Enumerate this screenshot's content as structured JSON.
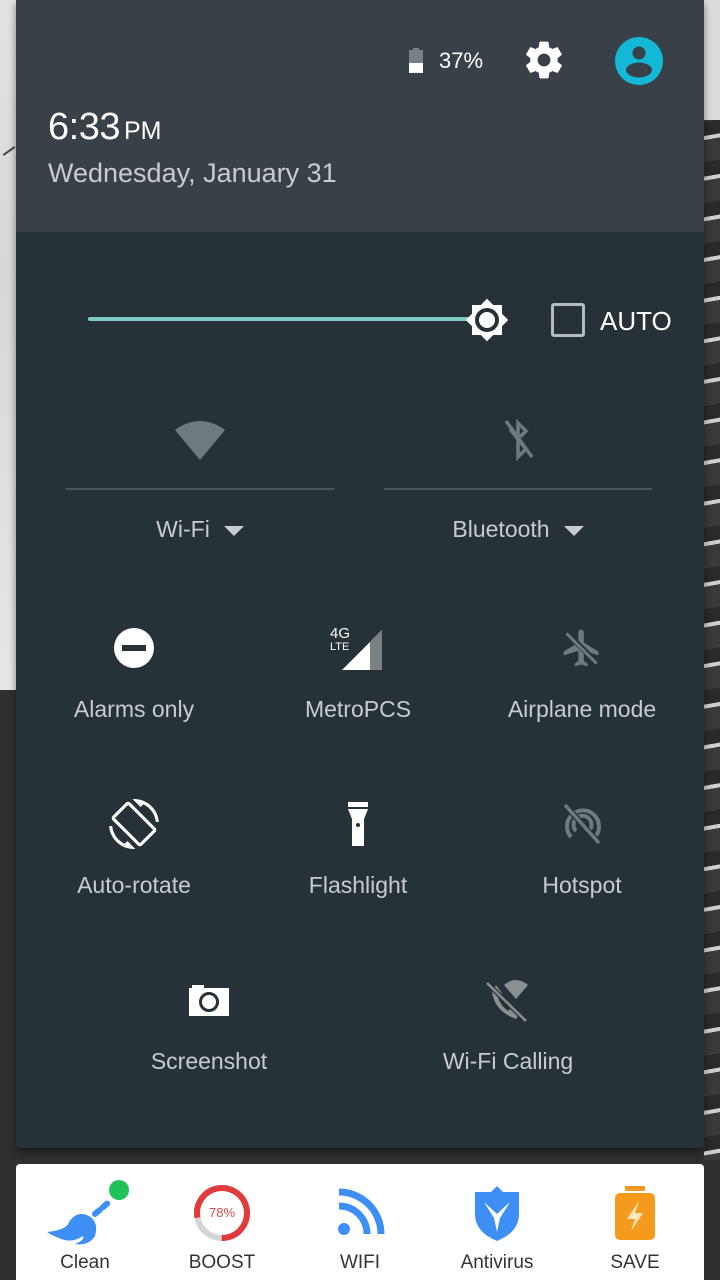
{
  "status": {
    "battery_percent": "37%",
    "battery_level": 0.37,
    "settings_icon": "gear-icon",
    "user_icon": "account-circle-icon"
  },
  "header": {
    "time": "6:33",
    "ampm": "PM",
    "date": "Wednesday, January 31"
  },
  "brightness": {
    "level": 0.95,
    "auto_label": "AUTO",
    "auto_checked": false
  },
  "big_tiles": [
    {
      "label": "Wi-Fi",
      "icon": "wifi-icon",
      "state": "off"
    },
    {
      "label": "Bluetooth",
      "icon": "bluetooth-disabled-icon",
      "state": "off"
    }
  ],
  "tiles": [
    {
      "label": "Alarms only",
      "icon": "do-not-disturb-icon",
      "state": "on"
    },
    {
      "label": "MetroPCS",
      "icon": "cellular-4g-lte-icon",
      "state": "on",
      "network": "4G",
      "network_sub": "LTE"
    },
    {
      "label": "Airplane mode",
      "icon": "airplane-off-icon",
      "state": "off"
    },
    {
      "label": "Auto-rotate",
      "icon": "screen-rotation-icon",
      "state": "on"
    },
    {
      "label": "Flashlight",
      "icon": "flashlight-icon",
      "state": "on"
    },
    {
      "label": "Hotspot",
      "icon": "hotspot-off-icon",
      "state": "off"
    },
    {
      "label": "Screenshot",
      "icon": "camera-icon",
      "state": "on"
    },
    {
      "label": "Wi-Fi Calling",
      "icon": "wifi-calling-off-icon",
      "state": "off"
    }
  ],
  "cleaner_bar": {
    "items": [
      {
        "label": "Clean",
        "icon": "broom-icon"
      },
      {
        "label": "BOOST",
        "icon": "boost-ring-icon",
        "value": "78%",
        "fraction": 0.78
      },
      {
        "label": "WIFI",
        "icon": "wifi-signal-icon"
      },
      {
        "label": "Antivirus",
        "icon": "shield-icon"
      },
      {
        "label": "SAVE",
        "icon": "battery-saver-icon"
      }
    ],
    "colors": {
      "blue": "#3d8ff5",
      "green": "#1fc15a",
      "red": "#e03a3a",
      "orange": "#f59a1c"
    }
  },
  "colors": {
    "shade_bg": "#263238",
    "header_bg": "#384048",
    "accent": "#80cbc4",
    "avatar": "#13b8d4",
    "icon_off": "#6f7a7f"
  }
}
